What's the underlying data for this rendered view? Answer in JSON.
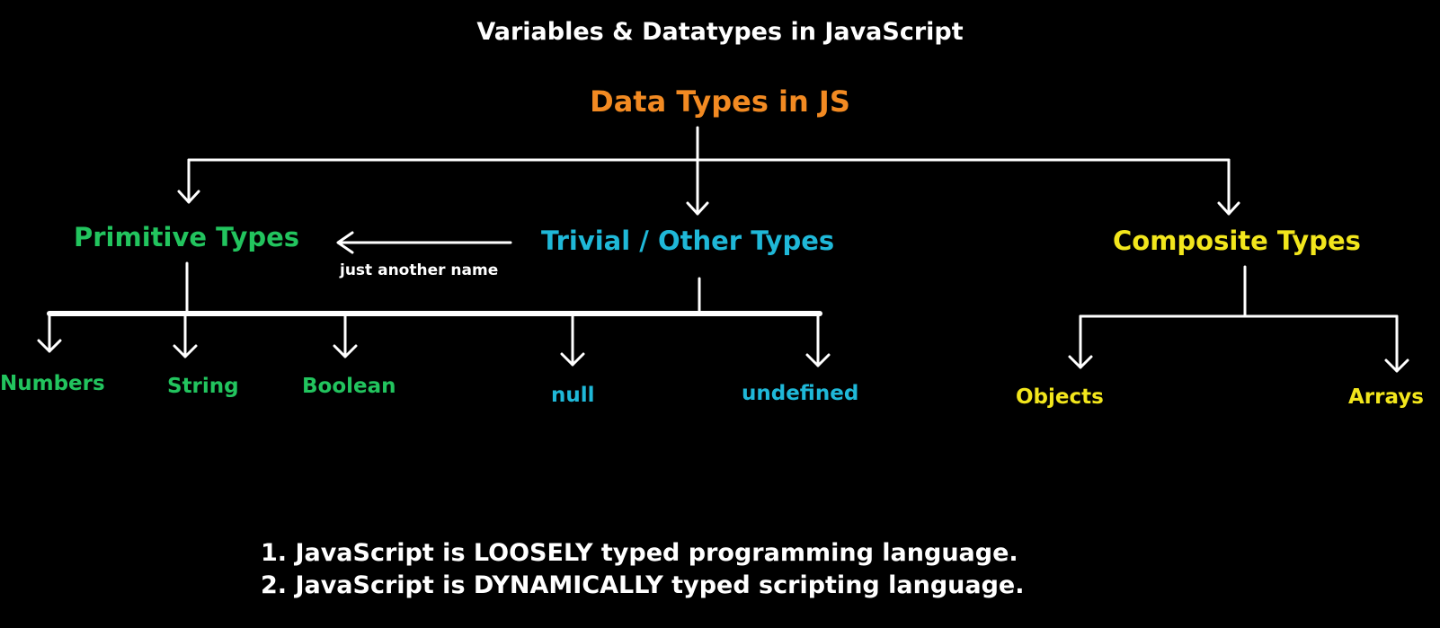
{
  "title": "Variables & Datatypes in JavaScript",
  "root": {
    "label": "Data Types in JS"
  },
  "categories": {
    "primitive": {
      "label": "Primitive Types"
    },
    "trivial": {
      "label": "Trivial / Other Types"
    },
    "composite": {
      "label": "Composite Types"
    }
  },
  "alias_note": "just another name",
  "leaves": {
    "numbers": "Numbers",
    "string": "String",
    "boolean": "Boolean",
    "null": "null",
    "undefined": "undefined",
    "objects": "Objects",
    "arrays": "Arrays"
  },
  "notes": [
    "1. JavaScript is LOOSELY typed programming language.",
    "2. JavaScript is DYNAMICALLY typed scripting language."
  ],
  "colors": {
    "background": "#000000",
    "text": "#ffffff",
    "root": "#f28a22",
    "primitive": "#22c45e",
    "trivial": "#1fb8d8",
    "composite": "#f2e61c",
    "lines": "#ffffff"
  }
}
